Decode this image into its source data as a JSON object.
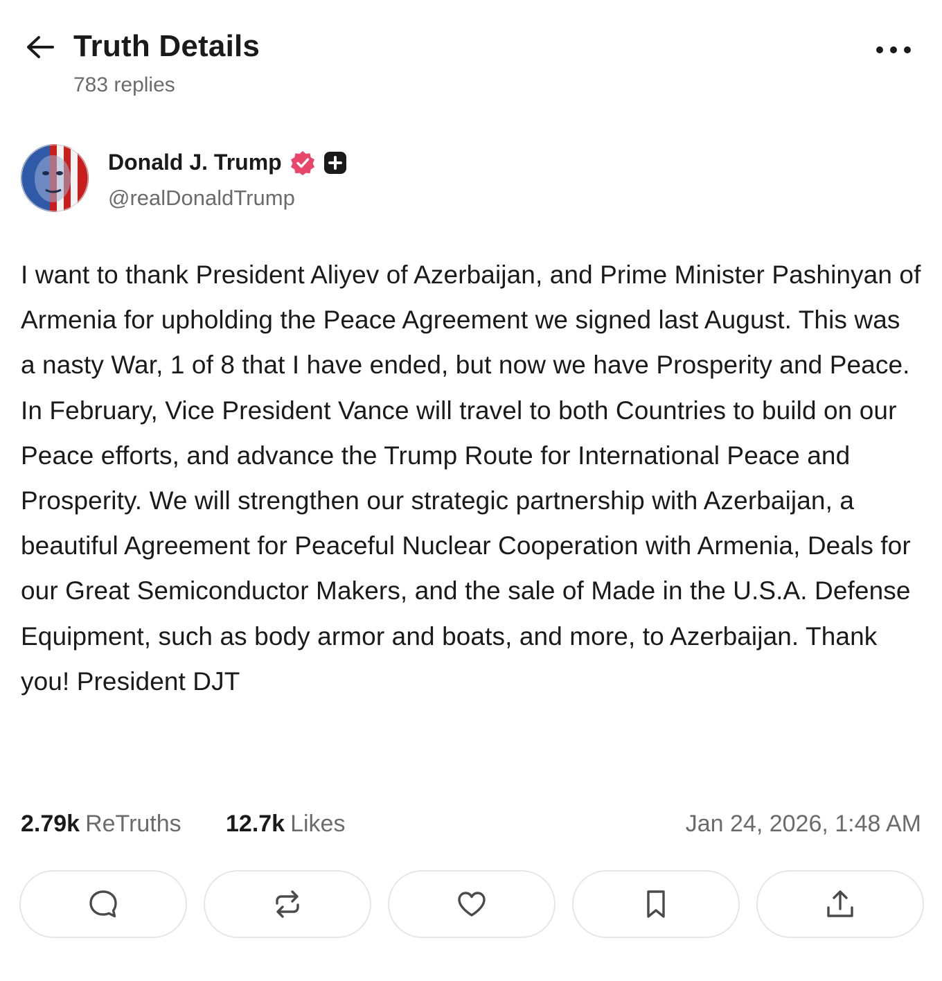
{
  "header": {
    "title": "Truth Details",
    "reply_count": "783 replies",
    "back_icon": "arrow-left-icon",
    "more_icon": "more-horizontal-icon"
  },
  "author": {
    "display_name": "Donald J. Trump",
    "handle": "@realDonaldTrump",
    "verified_badge_color": "#e8476b",
    "plus_badge_color": "#1a1a1a"
  },
  "post": {
    "text": "I want to thank President Aliyev of Azerbaijan, and Prime Minister Pashinyan of Armenia for upholding the Peace Agreement we signed last August. This was a nasty War, 1 of 8 that I have ended, but now we have Prosperity and Peace. In February, Vice President Vance will travel to both Countries to build on our Peace efforts, and advance the Trump Route for International Peace and Prosperity. We will strengthen our strategic partnership with Azerbaijan, a beautiful Agreement for Peaceful Nuclear Cooperation with Armenia, Deals for our Great Semiconductor Makers, and the sale of Made in the U.S.A. Defense Equipment, such as body armor and boats, and more, to Azerbaijan. Thank you! President DJT"
  },
  "stats": {
    "retruths_count": "2.79k",
    "retruths_label": "ReTruths",
    "likes_count": "12.7k",
    "likes_label": "Likes",
    "timestamp": "Jan 24, 2026, 1:48 AM"
  },
  "actions": [
    {
      "icon": "reply-icon"
    },
    {
      "icon": "retruth-icon"
    },
    {
      "icon": "heart-icon"
    },
    {
      "icon": "bookmark-icon"
    },
    {
      "icon": "share-icon"
    }
  ]
}
